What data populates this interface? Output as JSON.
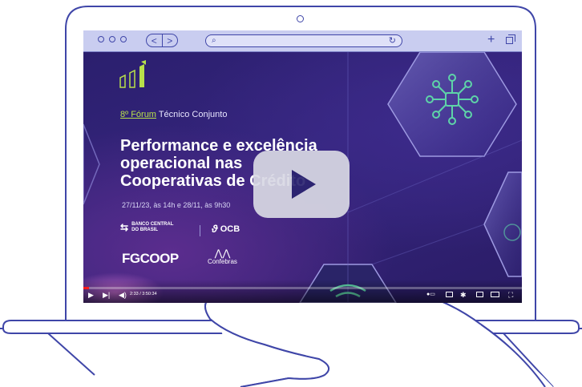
{
  "browser": {
    "nav_back": "<",
    "nav_forward": ">",
    "search_glyph": "⌕",
    "reload_glyph": "↻",
    "new_tab": "+"
  },
  "video": {
    "forum_highlight": "8º Fórum",
    "forum_rest": " Técnico Conjunto",
    "title_lines": [
      "Performance e excelência",
      "operacional nas",
      "Cooperativas de Crédito"
    ],
    "dates": "27/11/23, às 14h e 28/11, às 9h30",
    "sponsors": {
      "bcb_line1": "BANCO CENTRAL",
      "bcb_line2": "DO BRASIL",
      "ocb": "OCB",
      "fgcoop": "FGCOOP",
      "confebras": "Confebras"
    },
    "player": {
      "timecode": "2:33 / 3:50:34",
      "progress_fraction": 0.012
    }
  },
  "colors": {
    "outline": "#3f46a8",
    "chrome_bg": "#c9cdf0",
    "accent_green": "#b8e04a",
    "progress_red": "#ff1a1a"
  },
  "icons": {
    "play": "play-icon",
    "next": "next-icon",
    "volume": "volume-icon",
    "captions": "captions-icon",
    "settings": "gear-icon",
    "miniplayer": "miniplayer-icon",
    "theater": "theater-icon",
    "fullscreen": "fullscreen-icon"
  }
}
